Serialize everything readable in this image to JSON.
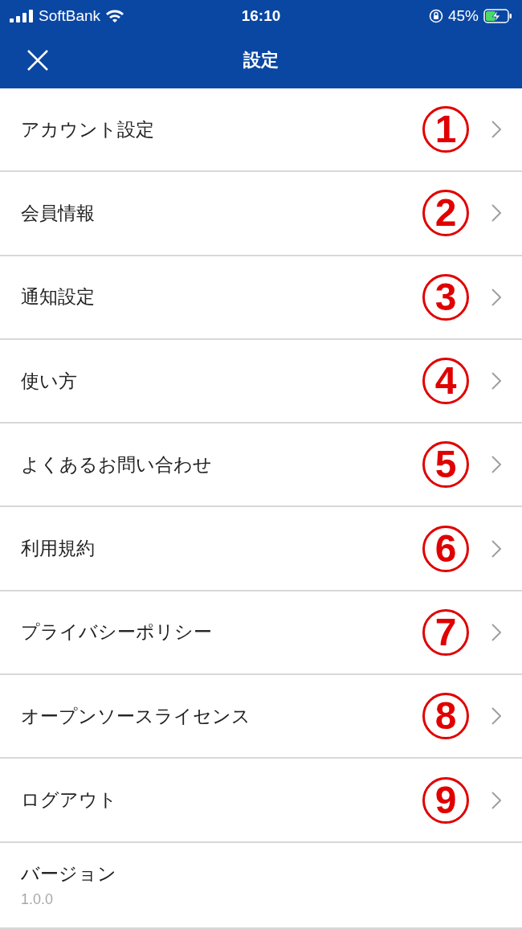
{
  "status_bar": {
    "carrier": "SoftBank",
    "time": "16:10",
    "battery_percent": "45%",
    "charging": true
  },
  "header": {
    "title": "設定"
  },
  "items": [
    {
      "label": "アカウント設定",
      "badge": "1"
    },
    {
      "label": "会員情報",
      "badge": "2"
    },
    {
      "label": "通知設定",
      "badge": "3"
    },
    {
      "label": "使い方",
      "badge": "4"
    },
    {
      "label": "よくあるお問い合わせ",
      "badge": "5"
    },
    {
      "label": "利用規約",
      "badge": "6"
    },
    {
      "label": "プライバシーポリシー",
      "badge": "7"
    },
    {
      "label": "オープンソースライセンス",
      "badge": "8"
    },
    {
      "label": "ログアウト",
      "badge": "9"
    }
  ],
  "version": {
    "label": "バージョン",
    "value": "1.0.0"
  }
}
